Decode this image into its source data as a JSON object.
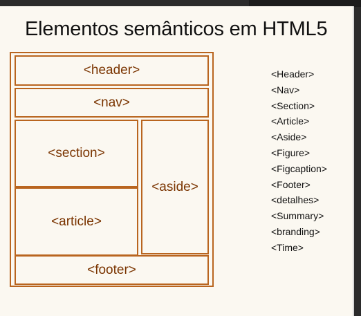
{
  "title": "Elementos semânticos em HTML5",
  "layout_boxes": {
    "header": "<header>",
    "nav": "<nav>",
    "section": "<section>",
    "article": "<article>",
    "aside": "<aside>",
    "footer": "<footer>"
  },
  "tag_list": [
    "<Header>",
    "<Nav>",
    "<Section>",
    "<Article>",
    "<Aside>",
    "<Figure>",
    "<Figcaption>",
    "<Footer>",
    "<detalhes>",
    "<Summary>",
    "<branding>",
    "<Time>"
  ],
  "colors": {
    "box_border": "#b9651f",
    "box_text": "#7a3400",
    "background": "#fbf8f1"
  }
}
